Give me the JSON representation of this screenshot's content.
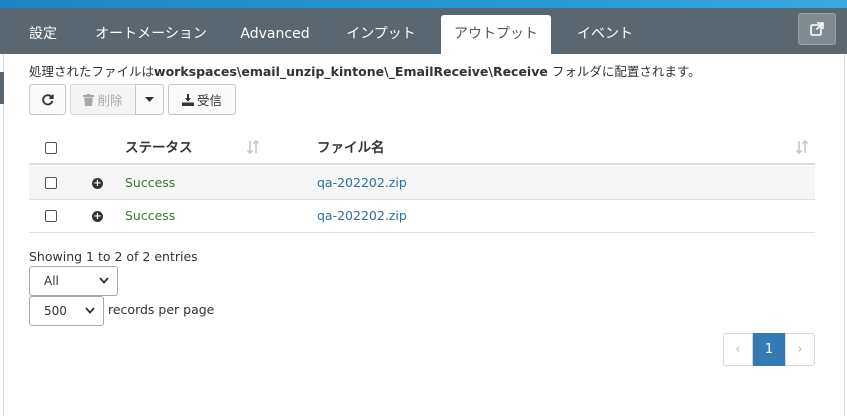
{
  "tabs": [
    {
      "label": "設定",
      "active": false
    },
    {
      "label": "オートメーション",
      "active": false
    },
    {
      "label": "Advanced",
      "active": false
    },
    {
      "label": "インプット",
      "active": false
    },
    {
      "label": "アウトプット",
      "active": true
    },
    {
      "label": "イベント",
      "active": false
    }
  ],
  "info": {
    "prefix": "処理されたファイルは",
    "path": "workspaces\\email_unzip_kintone\\_EmailReceive\\Receive",
    "suffix": " フォルダに配置されます。"
  },
  "toolbar": {
    "refresh_icon": "refresh-icon",
    "delete_label": "削除",
    "receive_label": "受信"
  },
  "table": {
    "columns": [
      "ステータス",
      "ファイル名"
    ],
    "rows": [
      {
        "status": "Success",
        "filename": "qa-202202.zip"
      },
      {
        "status": "Success",
        "filename": "qa-202202.zip"
      }
    ]
  },
  "footer": {
    "showing": "Showing 1 to 2 of 2 entries",
    "filter_selected": "All",
    "page_size_selected": "500",
    "records_per_page": "records per page"
  },
  "pagination": {
    "prev": "‹",
    "current": "1",
    "next": "›"
  },
  "colors": {
    "tabbar": "#5b6770",
    "accent": "#337ab7",
    "status_success": "#3c7a2a",
    "link": "#2f6e9e"
  }
}
